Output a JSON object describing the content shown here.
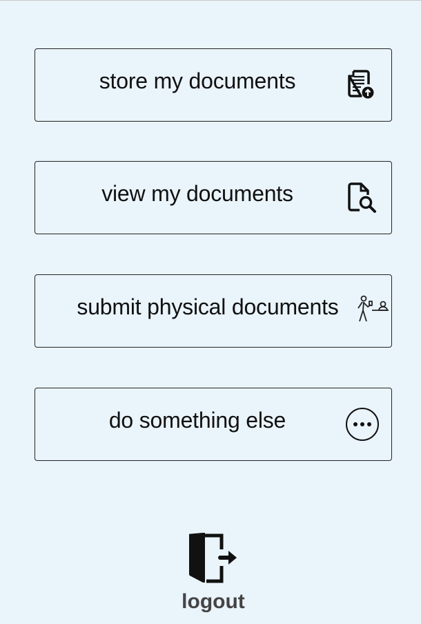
{
  "menu": [
    {
      "label": "store my documents",
      "icon": "document-upload-icon"
    },
    {
      "label": "view my documents",
      "icon": "document-search-icon"
    },
    {
      "label": "submit physical documents",
      "icon": "person-handing-document-icon"
    },
    {
      "label": "do something else",
      "icon": "more-dots-icon"
    }
  ],
  "logout": {
    "label": "logout",
    "icon": "logout-door-icon"
  },
  "colors": {
    "background": "#eaf4fb",
    "border": "#222222",
    "text": "#111111"
  }
}
